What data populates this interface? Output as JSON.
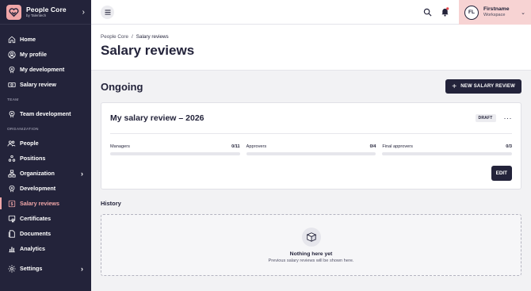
{
  "brand": {
    "title": "People Core",
    "subtitle": "by Talentech"
  },
  "sidebar": {
    "items_top": [
      {
        "label": "Home",
        "icon": "home-icon"
      },
      {
        "label": "My profile",
        "icon": "user-icon"
      },
      {
        "label": "My development",
        "icon": "development-icon"
      },
      {
        "label": "Salary review",
        "icon": "money-icon"
      }
    ],
    "team_label": "TEAM",
    "items_team": [
      {
        "label": "Team development",
        "icon": "development-icon"
      }
    ],
    "org_label": "ORGANIZATION",
    "items_org": [
      {
        "label": "People",
        "icon": "people-icon"
      },
      {
        "label": "Positions",
        "icon": "positions-icon"
      },
      {
        "label": "Organization",
        "icon": "org-icon"
      },
      {
        "label": "Development",
        "icon": "development-icon"
      },
      {
        "label": "Salary reviews",
        "icon": "salary-icon"
      },
      {
        "label": "Certificates",
        "icon": "certificate-icon"
      },
      {
        "label": "Documents",
        "icon": "documents-icon"
      },
      {
        "label": "Analytics",
        "icon": "analytics-icon"
      }
    ],
    "settings_label": "Settings"
  },
  "user": {
    "initials": "FL",
    "name": "Firstname",
    "workspace": "Workspace"
  },
  "breadcrumb": {
    "root": "People Core",
    "separator": "/",
    "current": "Salary reviews"
  },
  "page": {
    "title": "Salary reviews"
  },
  "ongoing": {
    "title": "Ongoing",
    "new_button": "NEW SALARY REVIEW"
  },
  "review_card": {
    "title": "My salary review – 2026",
    "status": "DRAFT",
    "more": "···",
    "progress": [
      {
        "label": "Managers",
        "value": "0/11",
        "fraction": 0
      },
      {
        "label": "Approvers",
        "value": "0/4",
        "fraction": 0
      },
      {
        "label": "Final approvers",
        "value": "0/3",
        "fraction": 0
      }
    ],
    "edit_button": "EDIT"
  },
  "history": {
    "title": "History",
    "empty_title": "Nothing here yet",
    "empty_subtitle": "Previous salary reviews will be shown here."
  },
  "colors": {
    "sidebar": "#23233a",
    "accent": "#f0a6a8",
    "user_box": "#f7d3d3"
  }
}
